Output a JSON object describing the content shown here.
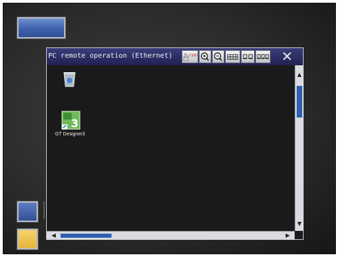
{
  "window": {
    "title": "PC remote operation (Ethernet)"
  },
  "desktop": {
    "icons": [
      {
        "name": "recycle-bin",
        "label": ""
      },
      {
        "name": "gt-designer3",
        "label": "GT Designer3"
      }
    ]
  },
  "colors": {
    "titlebar": "#2a2c66",
    "accent_blue": "#3e62ad",
    "accent_yellow": "#f0c24f",
    "scroll_thumb": "#2f5fb0"
  },
  "toolbar": {
    "buttons": [
      "click-cursor",
      "zoom-in",
      "zoom-out",
      "keyboard",
      "screen-switch",
      "ctrl-alt-del"
    ]
  }
}
